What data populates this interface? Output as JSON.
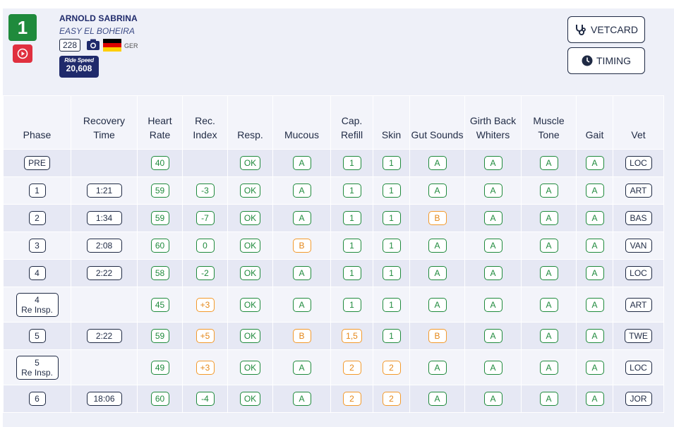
{
  "header": {
    "place": "1",
    "rider": "ARNOLD SABRINA",
    "horse": "EASY EL BOHEIRA",
    "number": "228",
    "country": "GER",
    "ride_speed_label": "Ride Speed",
    "ride_speed": "20,608",
    "flag_colors": [
      "#000000",
      "#dd0000",
      "#ffce00"
    ]
  },
  "buttons": {
    "vetcard": "VETCARD",
    "timing": "TIMING"
  },
  "columns": [
    "Phase",
    "Recovery Time",
    "Heart Rate",
    "Rec. Index",
    "Resp.",
    "Mucous",
    "Cap. Refill",
    "Skin",
    "Gut Sounds",
    "Girth Back Whiters",
    "Muscle Tone",
    "Gait",
    "Vet"
  ],
  "rows": [
    {
      "phase": "PRE",
      "phase2": "",
      "time": "",
      "hr": "40",
      "ri": "",
      "ri_c": "",
      "resp": "OK",
      "mucous": "A",
      "mucous_c": "g",
      "cap": "1",
      "cap_c": "g",
      "skin": "1",
      "skin_c": "g",
      "gut": "A",
      "gut_c": "g",
      "girth": "A",
      "muscle": "A",
      "gait": "A",
      "vet": "LOC"
    },
    {
      "phase": "1",
      "phase2": "",
      "time": "1:21",
      "hr": "59",
      "ri": "-3",
      "ri_c": "g",
      "resp": "OK",
      "mucous": "A",
      "mucous_c": "g",
      "cap": "1",
      "cap_c": "g",
      "skin": "1",
      "skin_c": "g",
      "gut": "A",
      "gut_c": "g",
      "girth": "A",
      "muscle": "A",
      "gait": "A",
      "vet": "ART"
    },
    {
      "phase": "2",
      "phase2": "",
      "time": "1:34",
      "hr": "59",
      "ri": "-7",
      "ri_c": "g",
      "resp": "OK",
      "mucous": "A",
      "mucous_c": "g",
      "cap": "1",
      "cap_c": "g",
      "skin": "1",
      "skin_c": "g",
      "gut": "B",
      "gut_c": "o",
      "girth": "A",
      "muscle": "A",
      "gait": "A",
      "vet": "BAS"
    },
    {
      "phase": "3",
      "phase2": "",
      "time": "2:08",
      "hr": "60",
      "ri": "0",
      "ri_c": "g",
      "resp": "OK",
      "mucous": "B",
      "mucous_c": "o",
      "cap": "1",
      "cap_c": "g",
      "skin": "1",
      "skin_c": "g",
      "gut": "A",
      "gut_c": "g",
      "girth": "A",
      "muscle": "A",
      "gait": "A",
      "vet": "VAN"
    },
    {
      "phase": "4",
      "phase2": "",
      "time": "2:22",
      "hr": "58",
      "ri": "-2",
      "ri_c": "g",
      "resp": "OK",
      "mucous": "A",
      "mucous_c": "g",
      "cap": "1",
      "cap_c": "g",
      "skin": "1",
      "skin_c": "g",
      "gut": "A",
      "gut_c": "g",
      "girth": "A",
      "muscle": "A",
      "gait": "A",
      "vet": "LOC"
    },
    {
      "phase": "4",
      "phase2": "Re Insp.",
      "time": "",
      "hr": "45",
      "ri": "+3",
      "ri_c": "o",
      "resp": "OK",
      "mucous": "A",
      "mucous_c": "g",
      "cap": "1",
      "cap_c": "g",
      "skin": "1",
      "skin_c": "g",
      "gut": "A",
      "gut_c": "g",
      "girth": "A",
      "muscle": "A",
      "gait": "A",
      "vet": "ART"
    },
    {
      "phase": "5",
      "phase2": "",
      "time": "2:22",
      "hr": "59",
      "ri": "+5",
      "ri_c": "o",
      "resp": "OK",
      "mucous": "B",
      "mucous_c": "o",
      "cap": "1,5",
      "cap_c": "o",
      "skin": "1",
      "skin_c": "g",
      "gut": "B",
      "gut_c": "o",
      "girth": "A",
      "muscle": "A",
      "gait": "A",
      "vet": "TWE"
    },
    {
      "phase": "5",
      "phase2": "Re Insp.",
      "time": "",
      "hr": "49",
      "ri": "+3",
      "ri_c": "o",
      "resp": "OK",
      "mucous": "A",
      "mucous_c": "g",
      "cap": "2",
      "cap_c": "o",
      "skin": "2",
      "skin_c": "o",
      "gut": "A",
      "gut_c": "g",
      "girth": "A",
      "muscle": "A",
      "gait": "A",
      "vet": "LOC"
    },
    {
      "phase": "6",
      "phase2": "",
      "time": "18:06",
      "hr": "60",
      "ri": "-4",
      "ri_c": "g",
      "resp": "OK",
      "mucous": "A",
      "mucous_c": "g",
      "cap": "2",
      "cap_c": "o",
      "skin": "2",
      "skin_c": "o",
      "gut": "A",
      "gut_c": "g",
      "girth": "A",
      "muscle": "A",
      "gait": "A",
      "vet": "JOR"
    }
  ]
}
